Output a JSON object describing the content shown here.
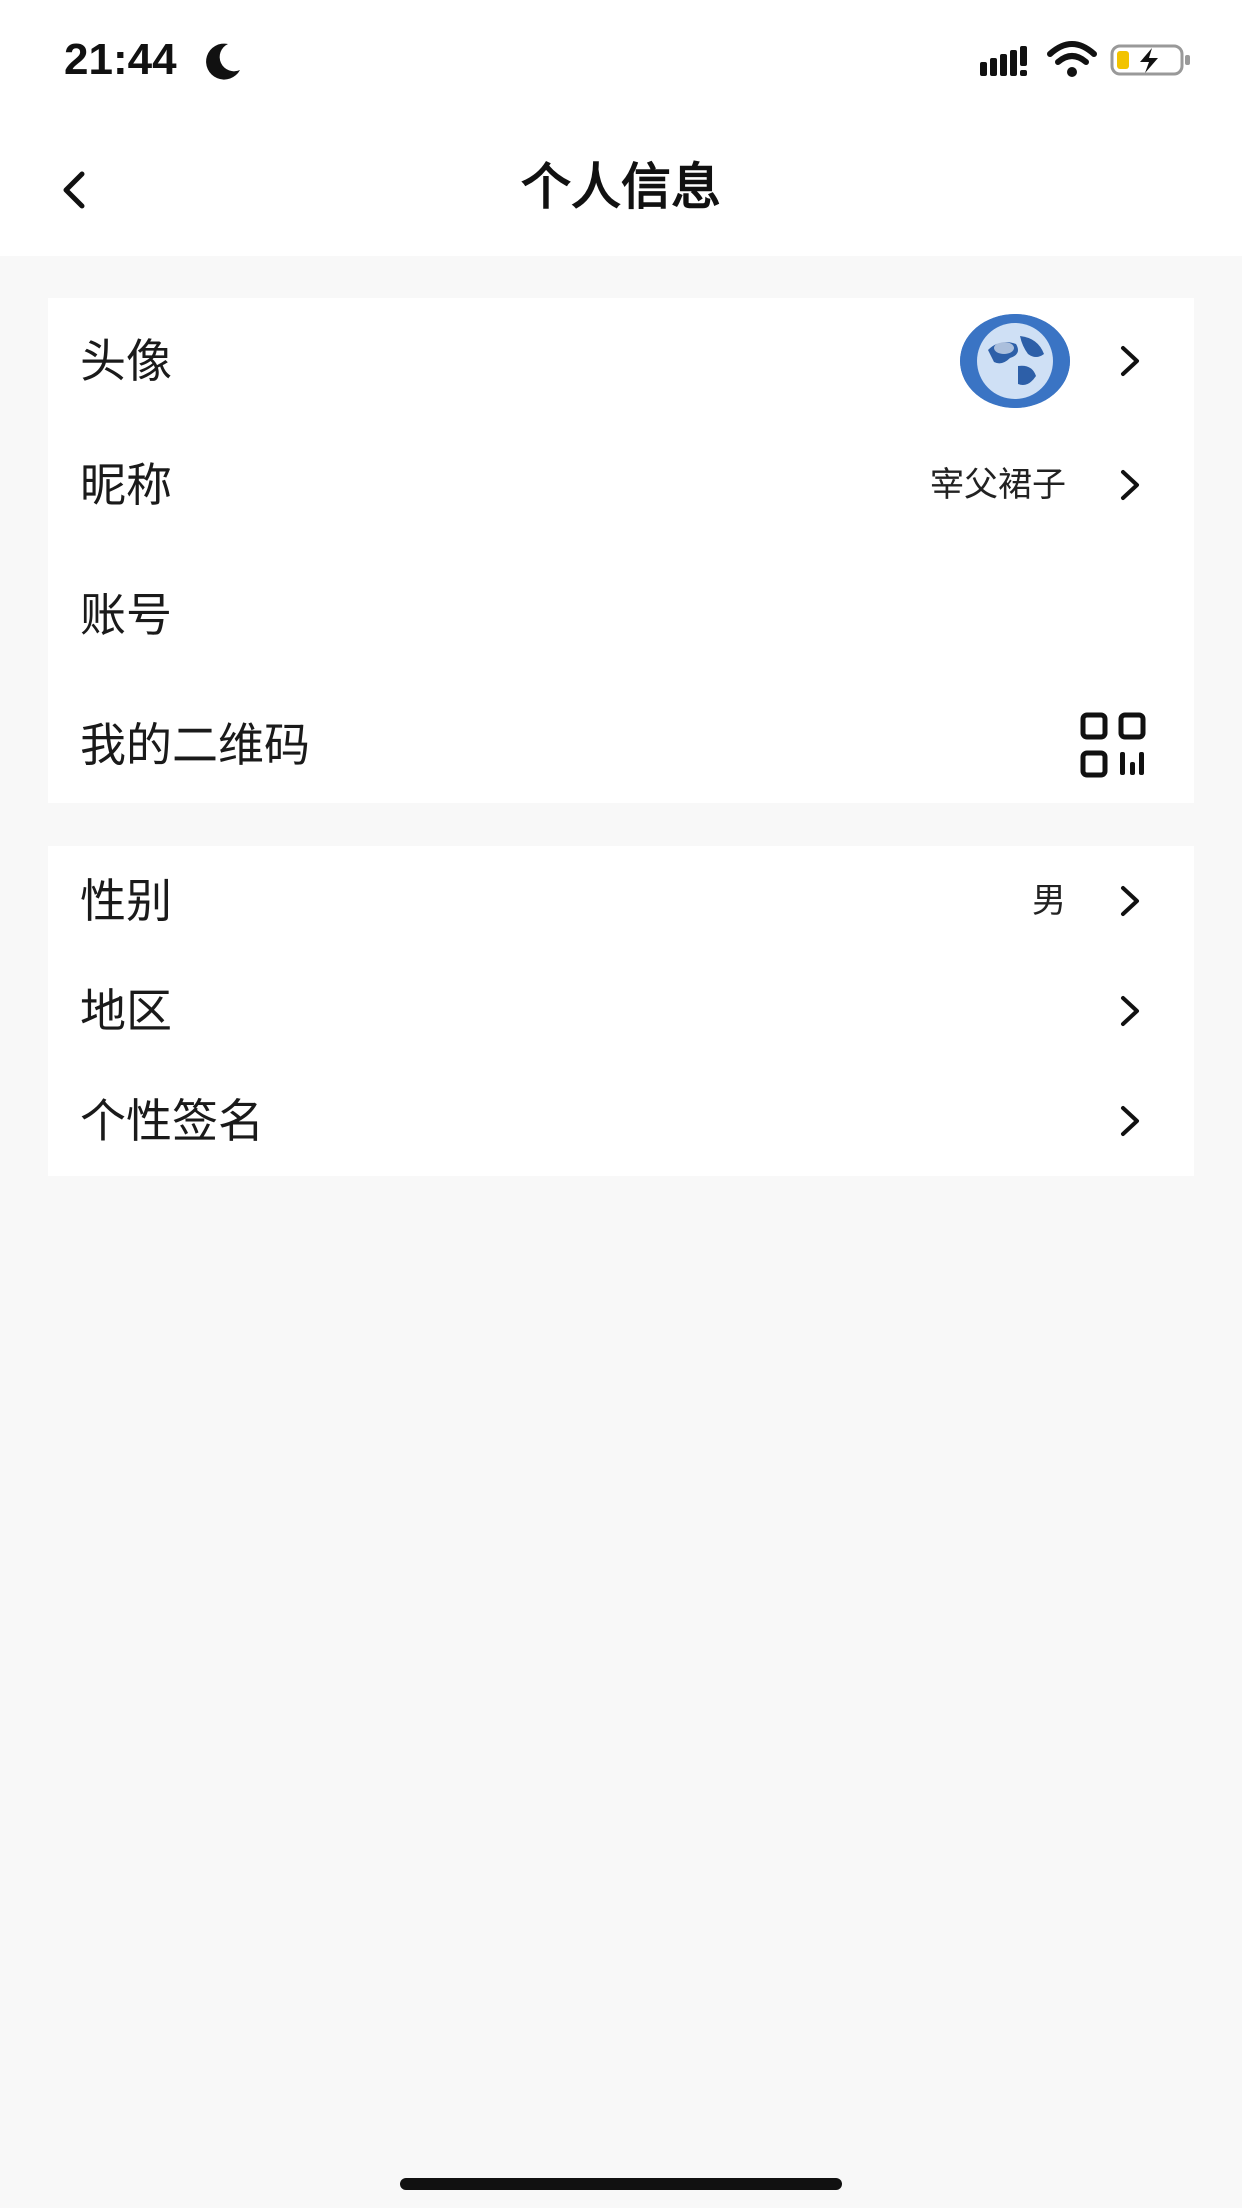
{
  "status_bar": {
    "time": "21:44"
  },
  "header": {
    "title": "个人信息"
  },
  "group1": {
    "avatar_label": "头像",
    "nickname_label": "昵称",
    "nickname_value": "宰父裙子",
    "account_label": "账号",
    "qrcode_label": "我的二维码"
  },
  "group2": {
    "gender_label": "性别",
    "gender_value": "男",
    "region_label": "地区",
    "signature_label": "个性签名"
  },
  "icons": {
    "back": "chevron-left-icon",
    "row_arrow": "chevron-right-icon",
    "qr": "qr-code-icon",
    "avatar": "globe-avatar"
  },
  "colors": {
    "background": "#f8f8f8",
    "card": "#ffffff",
    "text": "#1a1a1a",
    "avatar_blue": "#3a74c4"
  }
}
